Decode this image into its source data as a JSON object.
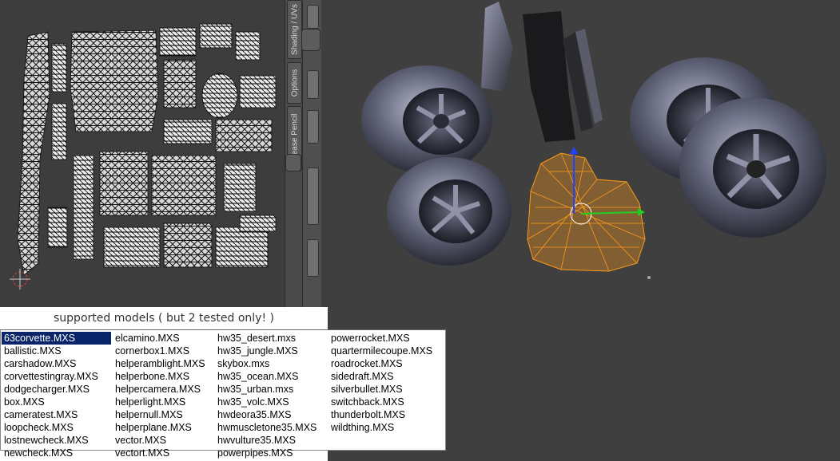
{
  "uv_tabs": [
    {
      "label": "Shading / UVs"
    },
    {
      "label": "Options"
    },
    {
      "label": "Grease Pencil"
    }
  ],
  "model_panel": {
    "title": "supported models ( but 2 tested only! )",
    "columns": [
      [
        "63corvette.MXS",
        "ballistic.MXS",
        "carshadow.MXS",
        "corvettestingray.MXS",
        "dodgecharger.MXS",
        "box.MXS",
        "cameratest.MXS",
        "loopcheck.MXS",
        "lostnewcheck.MXS",
        "newcheck.MXS"
      ],
      [
        "elcamino.MXS",
        "cornerbox1.MXS",
        "helperamblight.MXS",
        "helperbone.MXS",
        "helpercamera.MXS",
        "helperlight.MXS",
        "helpernull.MXS",
        "helperplane.MXS",
        "vector.MXS",
        "vectort.MXS"
      ],
      [
        "hw35_desert.mxs",
        "hw35_jungle.MXS",
        "skybox.mxs",
        "hw35_ocean.MXS",
        "hw35_urban.mxs",
        "hw35_volc.MXS",
        "hwdeora35.MXS",
        "hwmuscletone35.MXS",
        "hwvulture35.MXS",
        "powerpipes.MXS"
      ],
      [
        "powerrocket.MXS",
        "quartermilecoupe.MXS",
        "roadrocket.MXS",
        "sidedraft.MXS",
        "silverbullet.MXS",
        "switchback.MXS",
        "thunderbolt.MXS",
        "wildthing.MXS"
      ]
    ],
    "selected": "63corvette.MXS"
  },
  "colors": {
    "selection": "#0a246a",
    "wireframe": "#ff9a1a",
    "viewport_bg": "#3f3f3f"
  }
}
